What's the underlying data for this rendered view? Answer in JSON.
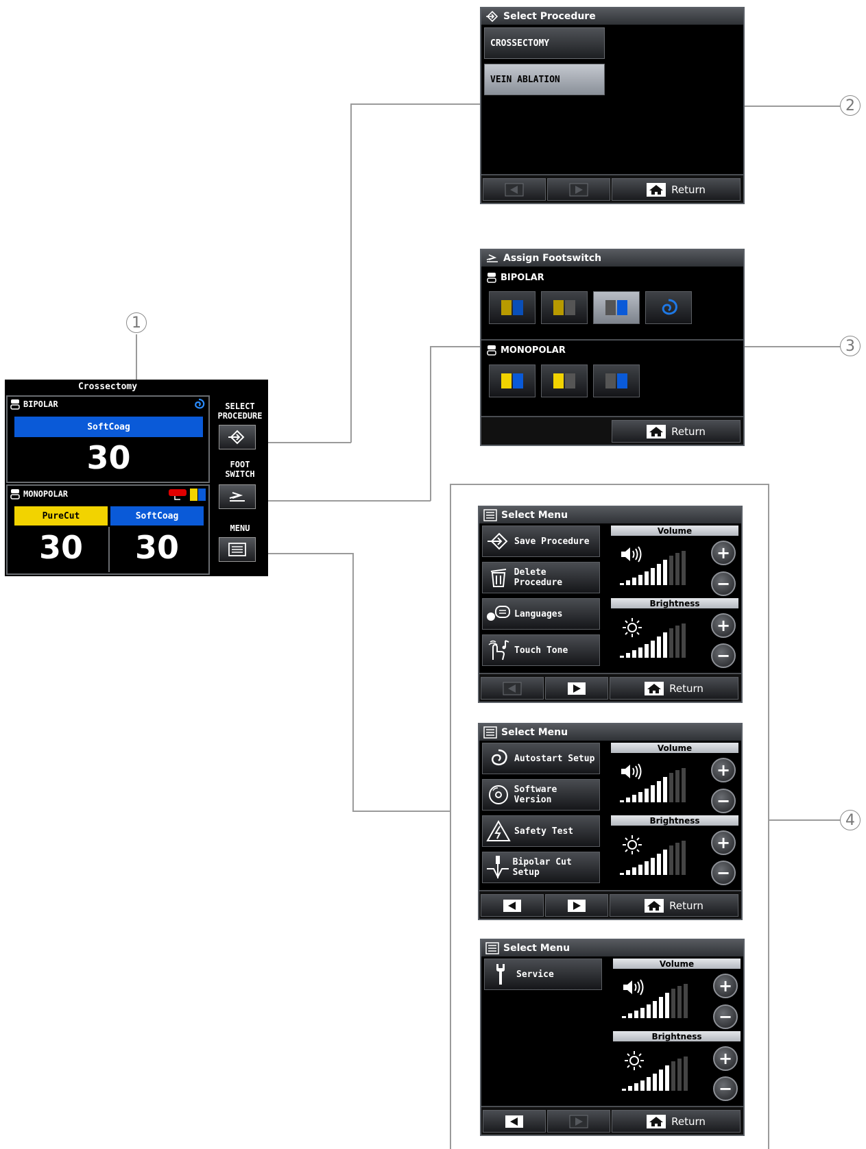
{
  "callouts": [
    "1",
    "2",
    "3",
    "4"
  ],
  "main_panel": {
    "title": "Crossectomy",
    "bipolar": {
      "label": "BIPOLAR",
      "mode": "SoftCoag",
      "value": "30"
    },
    "monopolar": {
      "label": "MONOPOLAR",
      "cut_mode": "PureCut",
      "cut_value": "30",
      "coag_mode": "SoftCoag",
      "coag_value": "30"
    },
    "buttons": {
      "select_procedure": "SELECT\nPROCEDURE",
      "foot_switch": "FOOT\nSWITCH",
      "menu": "MENU"
    }
  },
  "select_procedure_screen": {
    "title": "Select Procedure",
    "items": [
      "CROSSECTOMY",
      "VEIN ABLATION"
    ],
    "selected": "VEIN ABLATION",
    "return_label": "Return"
  },
  "assign_footswitch_screen": {
    "title": "Assign Footswitch",
    "bipolar_label": "BIPOLAR",
    "monopolar_label": "MONOPOLAR",
    "return_label": "Return"
  },
  "menu_screen_1": {
    "title": "Select Menu",
    "items": [
      "Save Procedure",
      "Delete Procedure",
      "Languages",
      "Touch Tone"
    ],
    "volume_label": "Volume",
    "brightness_label": "Brightness",
    "return_label": "Return"
  },
  "menu_screen_2": {
    "title": "Select Menu",
    "items": [
      "Autostart Setup",
      "Software Version",
      "Safety Test",
      "Bipolar Cut Setup"
    ],
    "volume_label": "Volume",
    "brightness_label": "Brightness",
    "return_label": "Return"
  },
  "menu_screen_3": {
    "title": "Select Menu",
    "items": [
      "Service"
    ],
    "volume_label": "Volume",
    "brightness_label": "Brightness",
    "return_label": "Return"
  },
  "colors": {
    "blue": "#0a5ad8",
    "yellow": "#f2d300",
    "red": "#e00000"
  }
}
